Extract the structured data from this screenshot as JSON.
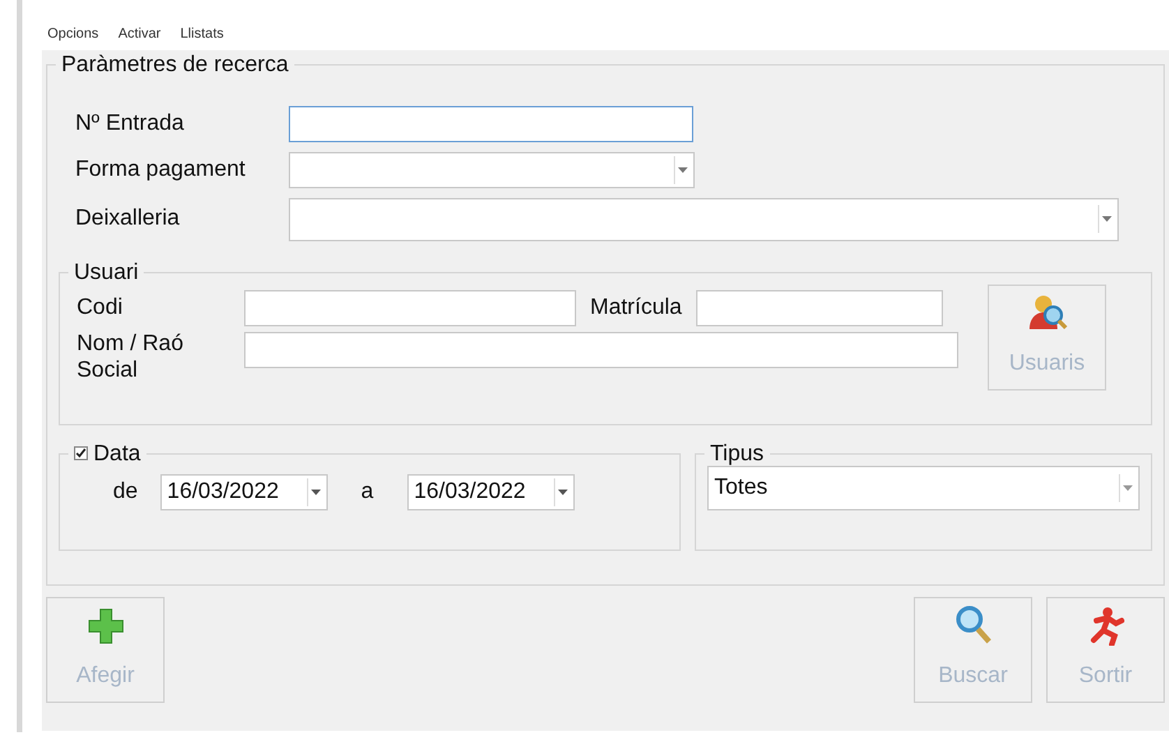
{
  "menu": [
    {
      "label": "Opcions"
    },
    {
      "label": "Activar"
    },
    {
      "label": "Llistats"
    }
  ],
  "search_group": {
    "title": "Paràmetres de recerca",
    "fields": [
      {
        "label": "Nº Entrada",
        "kind": "text",
        "focused": true
      },
      {
        "label": "Forma pagament",
        "kind": "combo",
        "focused": false
      },
      {
        "label": "Deixalleria",
        "kind": "combo-wide",
        "focused": false
      }
    ],
    "user_group": {
      "title": "Usuari",
      "code_label": "Codi",
      "plate_label": "Matrícula",
      "name_label": "Nom / Raó Social",
      "button": {
        "label": "Usuaris",
        "disabled": true
      }
    },
    "date_group": {
      "title": "Data",
      "checked": true,
      "from_label": "de",
      "from_value": "16/03/2022",
      "to_label": "a",
      "to_value": "16/03/2022"
    },
    "type_group": {
      "title": "Tipus",
      "value": "Totes"
    }
  },
  "buttons": [
    {
      "label": "Afegir",
      "disabled": true
    },
    {
      "label": "Buscar",
      "disabled": true
    },
    {
      "label": "Sortir",
      "disabled": true
    }
  ]
}
